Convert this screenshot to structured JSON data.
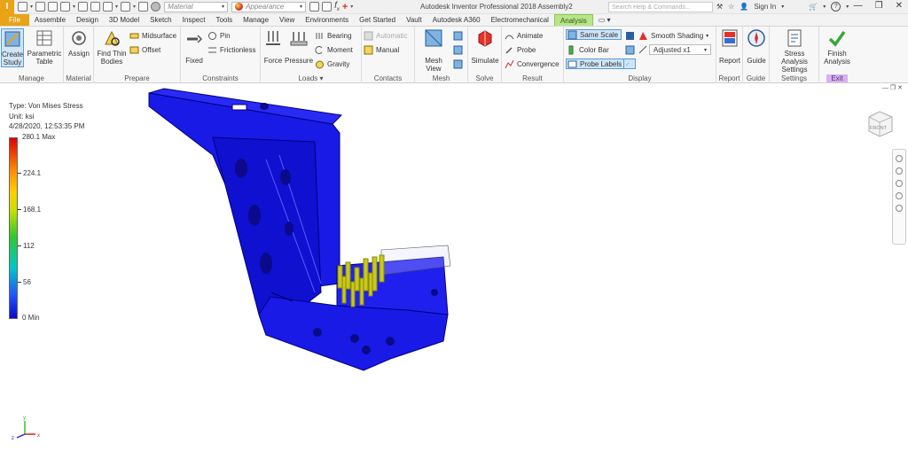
{
  "titlebar": {
    "logo": "I",
    "material_placeholder": "Material",
    "appearance_placeholder": "Appearance",
    "app_title": "Autodesk Inventor Professional 2018   Assembly2",
    "search_placeholder": "Search Help & Commands...",
    "sign_in": "Sign In",
    "help": "?"
  },
  "tabs": [
    "File",
    "Assemble",
    "Design",
    "3D Model",
    "Sketch",
    "Inspect",
    "Tools",
    "Manage",
    "View",
    "Environments",
    "Get Started",
    "Vault",
    "Autodesk A360",
    "Electromechanical",
    "Analysis"
  ],
  "active_tab": "Analysis",
  "ribbon": {
    "manage": {
      "label": "Manage",
      "create_study": [
        "Create",
        "Study"
      ],
      "parametric_table": [
        "Parametric",
        "Table"
      ]
    },
    "material": {
      "label": "Material",
      "assign": "Assign"
    },
    "prepare": {
      "label": "Prepare",
      "find_thin": [
        "Find Thin",
        "Bodies"
      ],
      "midsurface": "Midsurface",
      "offset": "Offset"
    },
    "constraints": {
      "label": "Constraints",
      "fixed": "Fixed",
      "pin": "Pin",
      "frictionless": "Frictionless"
    },
    "loads": {
      "label": "Loads",
      "force": "Force",
      "pressure": "Pressure",
      "bearing": "Bearing",
      "moment": "Moment",
      "gravity": "Gravity"
    },
    "contacts": {
      "label": "Contacts",
      "automatic": "Automatic",
      "manual": "Manual"
    },
    "mesh": {
      "label": "Mesh",
      "mesh_view": "Mesh View"
    },
    "solve": {
      "label": "Solve",
      "simulate": "Simulate"
    },
    "result": {
      "label": "Result",
      "animate": "Animate",
      "probe": "Probe",
      "convergence": "Convergence"
    },
    "display": {
      "label": "Display",
      "same_scale": "Same Scale",
      "color_bar": "Color Bar",
      "probe_labels": "Probe Labels",
      "smooth_shading": "Smooth Shading",
      "adjusted": "Adjusted x1"
    },
    "report": {
      "label": "Report",
      "report": "Report"
    },
    "guide": {
      "label": "Guide",
      "guide": "Guide"
    },
    "settings": {
      "label": "Settings",
      "stress_settings": [
        "Stress Analysis",
        "Settings"
      ]
    },
    "exit": {
      "label": "Exit",
      "finish": [
        "Finish",
        "Analysis"
      ]
    }
  },
  "legend": {
    "type": "Type: Von Mises Stress",
    "unit": "Unit: ksi",
    "date": "4/28/2020, 12:53:35 PM",
    "max": "280.1 Max",
    "v224": "224.1",
    "v168": "168.1",
    "v112": "112",
    "v56": "56",
    "min": "0 Min"
  },
  "viewcube_label": "FRONT",
  "colors": {
    "model": "#1a1ae6",
    "file_tab": "#e8a317",
    "analysis_tab": "#b9e58a",
    "exit_label": "#d6b3f0",
    "load_arrows": "#c8c81e"
  },
  "axis": {
    "x": "x",
    "y": "y",
    "z": "z"
  }
}
